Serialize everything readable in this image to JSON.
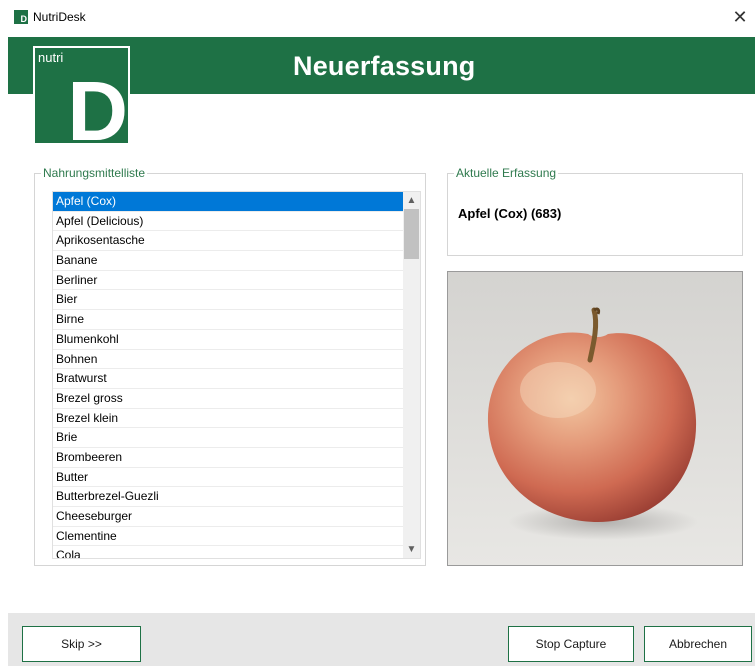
{
  "window": {
    "title": "NutriDesk",
    "close_glyph": "✕"
  },
  "logo": {
    "small_text": "nutri",
    "big_text": "D"
  },
  "header": {
    "title": "Neuerfassung"
  },
  "food_list": {
    "legend": "Nahrungsmittelliste",
    "selected_index": 0,
    "items": [
      "Apfel (Cox)",
      "Apfel (Delicious)",
      "Aprikosentasche",
      "Banane",
      "Berliner",
      "Bier",
      "Birne",
      "Blumenkohl",
      "Bohnen",
      "Bratwurst",
      "Brezel gross",
      "Brezel klein",
      "Brie",
      "Brombeeren",
      "Butter",
      "Butterbrezel-Guezli",
      "Cheeseburger",
      "Clementine",
      "Cola"
    ]
  },
  "current_capture": {
    "legend": "Aktuelle Erfassung",
    "value": "Apfel (Cox) (683)"
  },
  "photo": {
    "subject": "apple-photo"
  },
  "footer": {
    "skip_label": "Skip >>",
    "stop_label": "Stop Capture",
    "cancel_label": "Abbrechen"
  },
  "colors": {
    "brand_green": "#1e7145",
    "selection_blue": "#0078d7",
    "legend_green": "#2f7a4e"
  }
}
